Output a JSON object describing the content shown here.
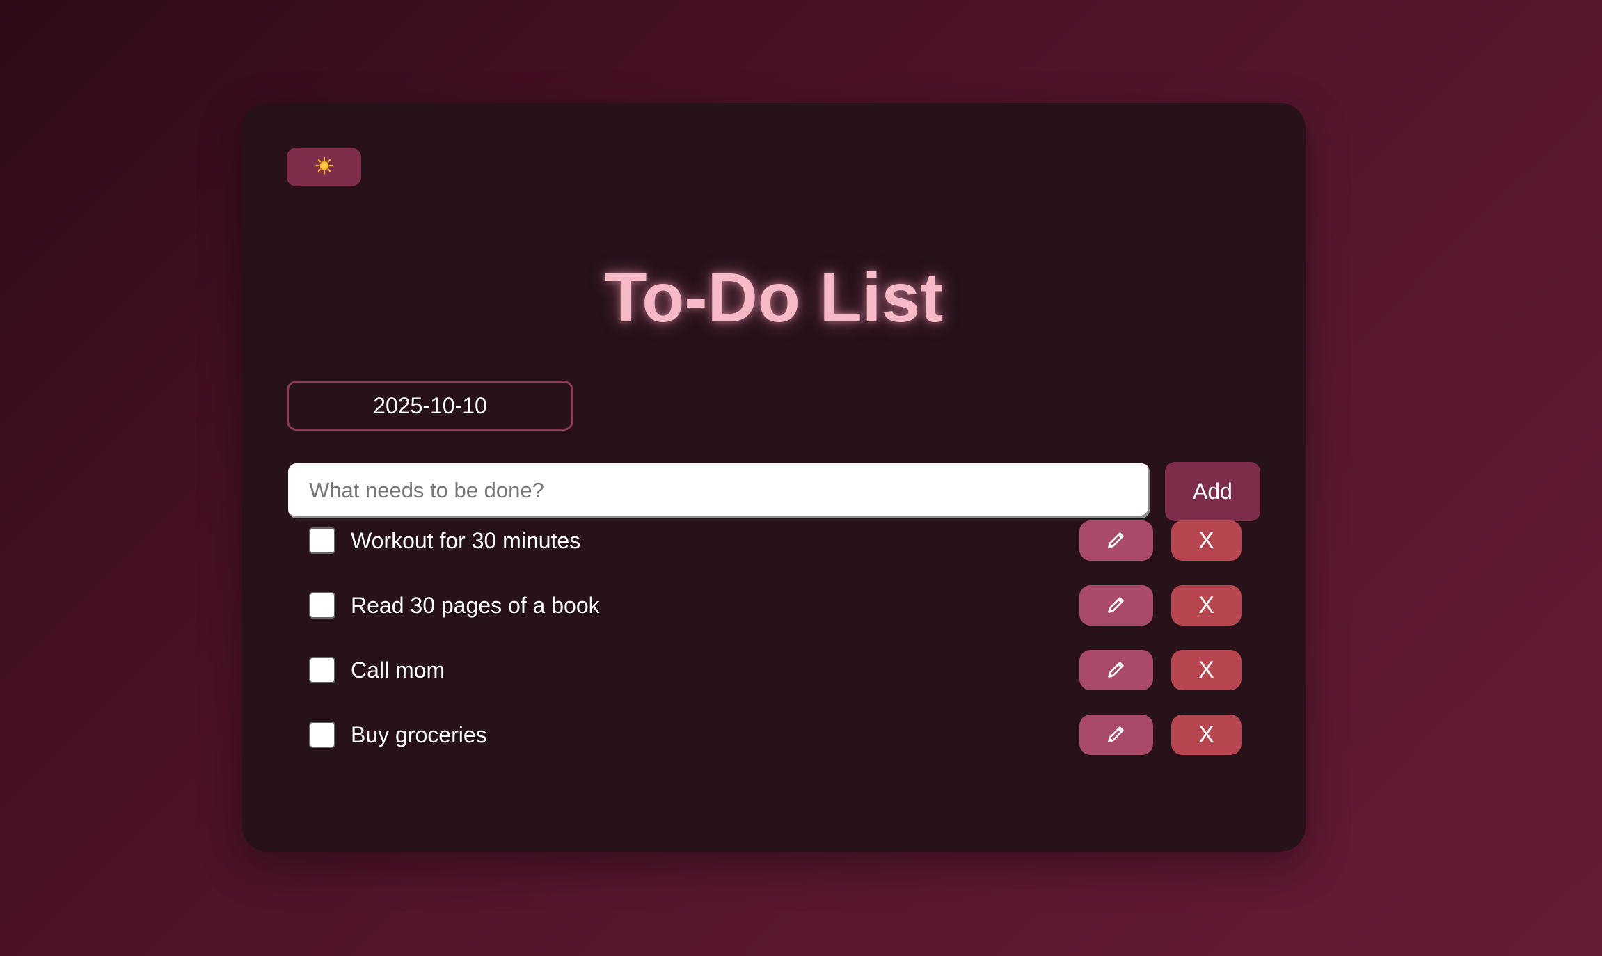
{
  "theme_toggle": {
    "icon": "sun-icon"
  },
  "title": "To-Do List",
  "date": {
    "value": "2025-10-10"
  },
  "new_task": {
    "value": "",
    "placeholder": "What needs to be done?"
  },
  "add_label": "Add",
  "todos": [
    {
      "text": "Workout for 30 minutes",
      "checked": false,
      "edit_icon": "pencil-icon",
      "delete_label": "X"
    },
    {
      "text": "Read 30 pages of a book",
      "checked": false,
      "edit_icon": "pencil-icon",
      "delete_label": "X"
    },
    {
      "text": "Call mom",
      "checked": false,
      "edit_icon": "pencil-icon",
      "delete_label": "X"
    },
    {
      "text": "Buy groceries",
      "checked": false,
      "edit_icon": "pencil-icon",
      "delete_label": "X"
    }
  ],
  "colors": {
    "card_bg": "#27121a",
    "accent": "#7d2d49",
    "title": "#f6b9c8",
    "edit_button": "#a84a68",
    "delete_button": "#b84650"
  }
}
